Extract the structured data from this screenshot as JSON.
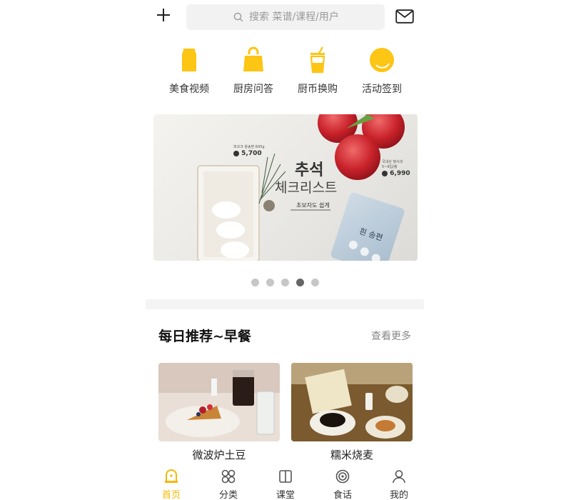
{
  "header": {
    "search_placeholder": "搜索 菜谱/课程/用户"
  },
  "quick_entries": [
    {
      "label": "美食视频",
      "icon": "food-video-icon"
    },
    {
      "label": "厨房问答",
      "icon": "kitchen-qa-icon"
    },
    {
      "label": "厨币换购",
      "icon": "coin-exchange-icon"
    },
    {
      "label": "活动签到",
      "icon": "checkin-icon"
    }
  ],
  "banner": {
    "title": "추석",
    "subtitle": "체크리스트",
    "tag": "초보자도 쉽게",
    "price_left_caption": "피코크 왕송편 600g",
    "price_left": "5,700",
    "price_right_caption": "국내산 햇사과 5~9입/봉",
    "price_right": "6,990",
    "package_text": "흰 송편",
    "slide_count": 5,
    "active_slide": 4
  },
  "section": {
    "title": "每日推荐~早餐",
    "more": "查看更多",
    "cards": [
      {
        "name": "微波炉土豆"
      },
      {
        "name": "糯米烧麦"
      }
    ]
  },
  "tabbar": {
    "items": [
      {
        "label": "首页",
        "icon": "home-icon",
        "active": true
      },
      {
        "label": "分类",
        "icon": "category-icon",
        "active": false
      },
      {
        "label": "课堂",
        "icon": "classroom-icon",
        "active": false
      },
      {
        "label": "食话",
        "icon": "food-talk-icon",
        "active": false
      },
      {
        "label": "我的",
        "icon": "profile-icon",
        "active": false
      }
    ]
  },
  "colors": {
    "accent": "#f5b800",
    "search_bg": "#f2f2f2"
  }
}
